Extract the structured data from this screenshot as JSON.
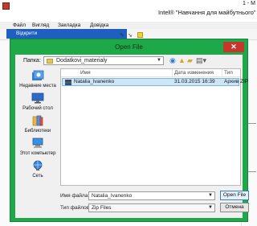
{
  "app": {
    "title": "Intel® \"Навчання для майбутнього\"",
    "title_right": "1 - М",
    "menu": [
      "Файл",
      "Вигляд",
      "Закладка",
      "Довідка"
    ],
    "left_tab_label": "Відкрити"
  },
  "dialog": {
    "title": "Open File",
    "close_glyph": "✕",
    "look_in": {
      "label": "Папка:",
      "value": "Dodatkovi_materialy"
    },
    "places": [
      {
        "label": "Недавние места",
        "icon": "recent-places-icon"
      },
      {
        "label": "Рабочий стол",
        "icon": "desktop-icon"
      },
      {
        "label": "Библиотеки",
        "icon": "libraries-icon"
      },
      {
        "label": "Этот компьютер",
        "icon": "computer-icon"
      },
      {
        "label": "Сеть",
        "icon": "network-icon"
      }
    ],
    "columns": [
      "Имя",
      "Дата изменения",
      "Тип"
    ],
    "files": [
      {
        "name": "Natalia_Ivanenko",
        "date": "31.03.2015 16:39",
        "type": "Архив ZIP"
      }
    ],
    "file_name": {
      "label": "Имя файла:",
      "value": "Natalia_Ivanenko"
    },
    "file_type": {
      "label": "Тип файлов:",
      "value": "Zip Files"
    },
    "open_button": "Open File",
    "cancel_button": "Отмена"
  },
  "colors": {
    "dialog_frame": "#1fa84a",
    "selection": "#cde6f7",
    "close": "#c7362a"
  }
}
